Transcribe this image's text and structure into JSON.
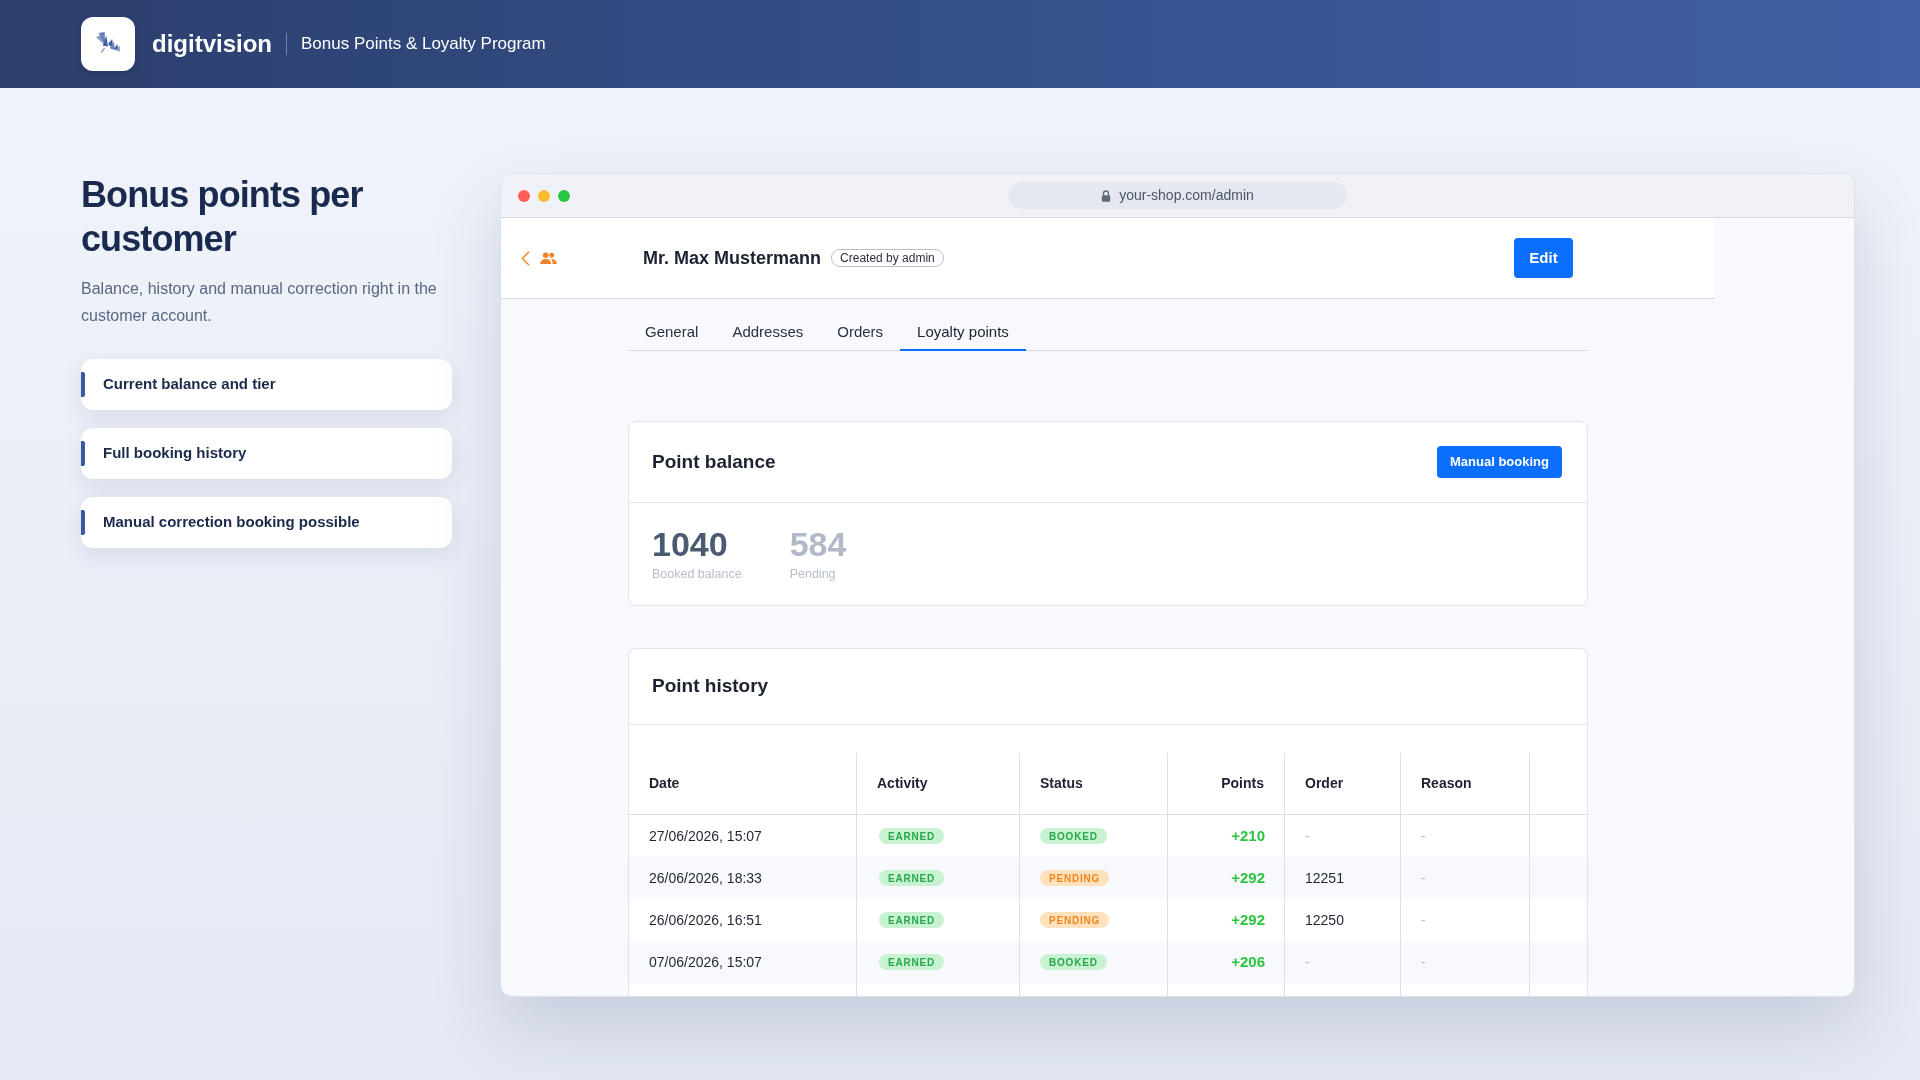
{
  "header": {
    "brand": "digitvision",
    "subtitle": "Bonus Points & Loyalty Program"
  },
  "intro": {
    "title": "Bonus points per customer",
    "description": "Balance, history and manual correction right in the customer account.",
    "features": [
      "Current balance and tier",
      "Full booking history",
      "Manual correction booking possible"
    ]
  },
  "browser": {
    "url": "your-shop.com/admin"
  },
  "customer": {
    "name": "Mr. Max Mustermann",
    "badge": "Created by admin",
    "edit_button": "Edit"
  },
  "tabs": [
    {
      "label": "General",
      "selected": false
    },
    {
      "label": "Addresses",
      "selected": false
    },
    {
      "label": "Orders",
      "selected": false
    },
    {
      "label": "Loyalty points",
      "selected": true
    }
  ],
  "point_balance": {
    "title": "Point balance",
    "button": "Manual booking",
    "stats": [
      {
        "value": "1040",
        "label": "Booked balance",
        "kind": "booked"
      },
      {
        "value": "584",
        "label": "Pending",
        "kind": "pending"
      }
    ]
  },
  "point_history": {
    "title": "Point history",
    "columns": [
      "Date",
      "Activity",
      "Status",
      "Points",
      "Order",
      "Reason"
    ],
    "rows": [
      {
        "date": "27/06/2026, 15:07",
        "activity": {
          "label": "EARNED",
          "kind": "success"
        },
        "status": {
          "label": "BOOKED",
          "kind": "success"
        },
        "points": "+210",
        "order": {
          "text": "-",
          "kind": "empty"
        },
        "reason": {
          "text": "-",
          "kind": "empty"
        }
      },
      {
        "date": "26/06/2026, 18:33",
        "activity": {
          "label": "EARNED",
          "kind": "success"
        },
        "status": {
          "label": "PENDING",
          "kind": "warning"
        },
        "points": "+292",
        "order": {
          "text": "12251",
          "kind": "value"
        },
        "reason": {
          "text": "-",
          "kind": "empty"
        }
      },
      {
        "date": "26/06/2026, 16:51",
        "activity": {
          "label": "EARNED",
          "kind": "success"
        },
        "status": {
          "label": "PENDING",
          "kind": "warning"
        },
        "points": "+292",
        "order": {
          "text": "12250",
          "kind": "value"
        },
        "reason": {
          "text": "-",
          "kind": "empty"
        }
      },
      {
        "date": "07/06/2026, 15:07",
        "activity": {
          "label": "EARNED",
          "kind": "success"
        },
        "status": {
          "label": "BOOKED",
          "kind": "success"
        },
        "points": "+206",
        "order": {
          "text": "-",
          "kind": "empty"
        },
        "reason": {
          "text": "-",
          "kind": "empty"
        }
      }
    ]
  }
}
